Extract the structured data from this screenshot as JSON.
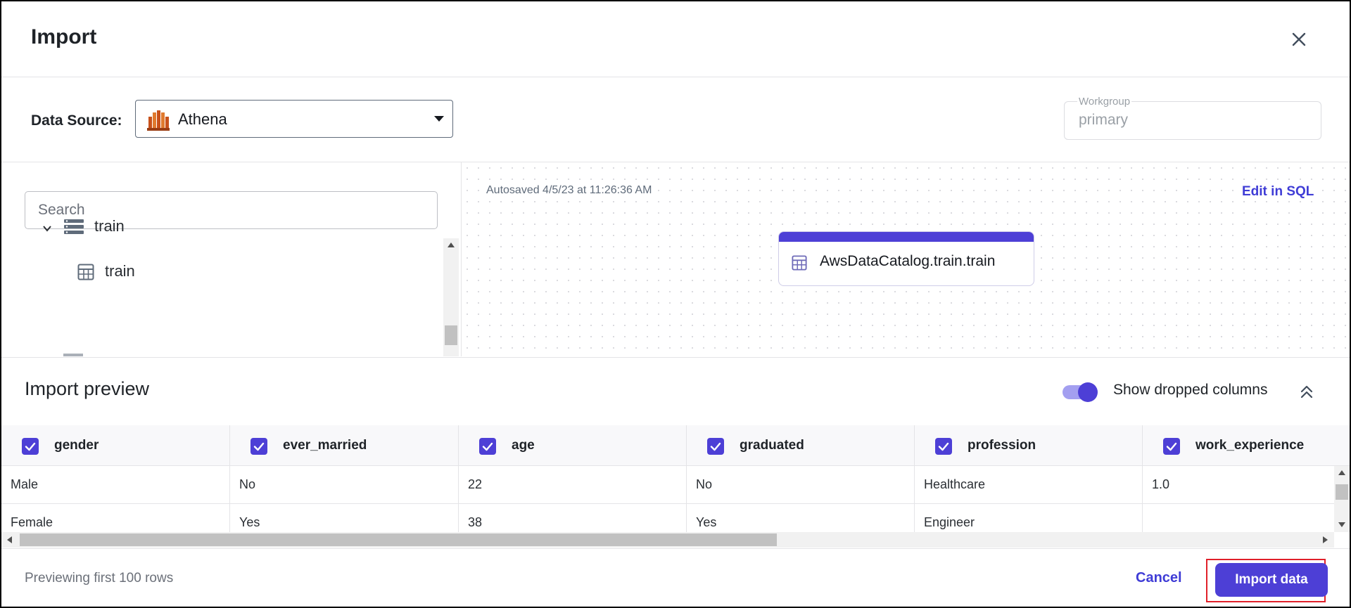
{
  "dialog": {
    "title": "Import",
    "close_icon": "close-icon"
  },
  "datasource": {
    "label": "Data Source:",
    "value": "Athena",
    "icon": "athena-logo-icon"
  },
  "workgroup": {
    "label": "Workgroup",
    "value": "primary"
  },
  "search": {
    "placeholder": "Search"
  },
  "tree": {
    "items": [
      {
        "label": "train",
        "icon": "database-icon",
        "expanded": true
      },
      {
        "label": "train",
        "icon": "table-icon"
      }
    ]
  },
  "canvas": {
    "autosaved": "Autosaved 4/5/23 at 11:26:36 AM",
    "edit_sql": "Edit in SQL",
    "node_label": "AwsDataCatalog.train.train",
    "node_color": "#4d3fd6"
  },
  "preview": {
    "title": "Import preview",
    "toggle_label": "Show dropped columns",
    "toggle_on": true,
    "columns": [
      "gender",
      "ever_married",
      "age",
      "graduated",
      "profession",
      "work_experience"
    ],
    "rows": [
      [
        "Male",
        "No",
        "22",
        "No",
        "Healthcare",
        "1.0"
      ],
      [
        "Female",
        "Yes",
        "38",
        "Yes",
        "Engineer",
        ""
      ]
    ]
  },
  "footer": {
    "note": "Previewing first 100 rows",
    "cancel": "Cancel",
    "import": "Import data"
  },
  "colors": {
    "accent": "#4d3fd6",
    "highlight": "#e0202a"
  }
}
